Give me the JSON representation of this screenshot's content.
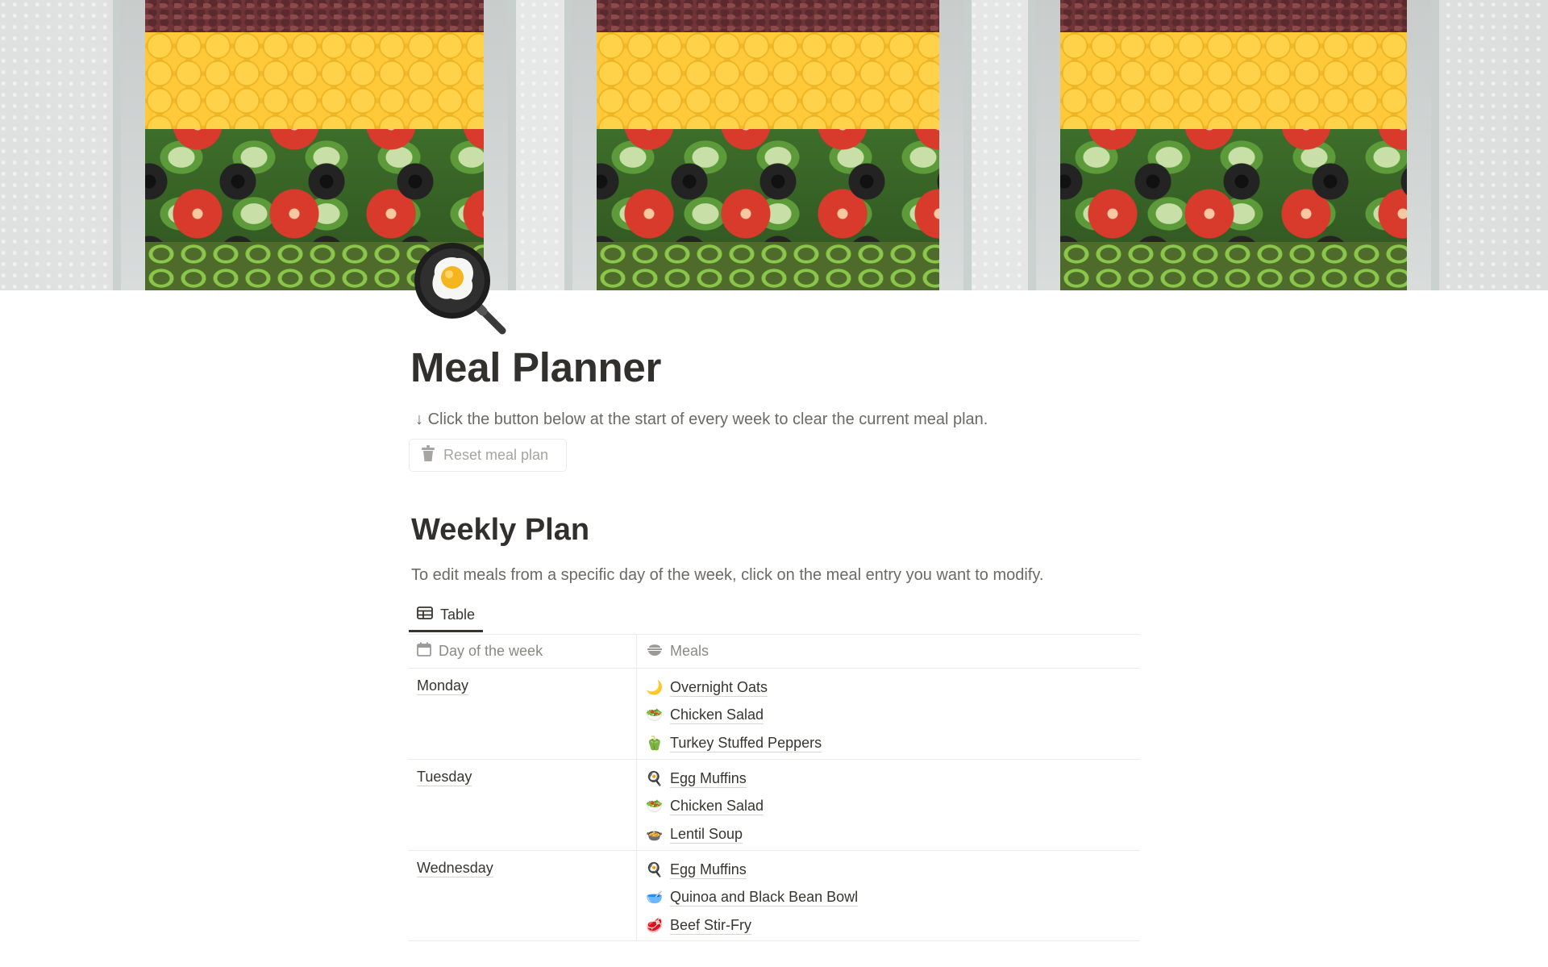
{
  "page": {
    "icon": "frying-pan-egg-icon",
    "title": "Meal Planner",
    "intro_arrow": "↓",
    "intro_text": "Click the button below at the start of every week to clear the current meal plan.",
    "reset_button": {
      "icon": "trash-icon",
      "label": "Reset meal plan"
    }
  },
  "section": {
    "title": "Weekly Plan",
    "description": "To edit meals from a specific day of the week, click on the meal entry you want to modify."
  },
  "view_tabs": [
    {
      "icon": "table-icon",
      "label": "Table",
      "active": true
    }
  ],
  "table": {
    "columns": [
      {
        "icon": "calendar-icon",
        "label": "Day of the week"
      },
      {
        "icon": "bowl-icon",
        "label": "Meals"
      }
    ],
    "rows": [
      {
        "day": "Monday",
        "meals": [
          {
            "emoji": "🌙",
            "name": "Overnight Oats"
          },
          {
            "emoji": "🥗",
            "name": "Chicken Salad"
          },
          {
            "emoji": "🫑",
            "name": "Turkey Stuffed Peppers"
          }
        ]
      },
      {
        "day": "Tuesday",
        "meals": [
          {
            "emoji": "🍳",
            "name": "Egg Muffins"
          },
          {
            "emoji": "🥗",
            "name": "Chicken Salad"
          },
          {
            "emoji": "🍲",
            "name": "Lentil Soup"
          }
        ]
      },
      {
        "day": "Wednesday",
        "meals": [
          {
            "emoji": "🍳",
            "name": "Egg Muffins"
          },
          {
            "emoji": "🥣",
            "name": "Quinoa and Black Bean Bowl"
          },
          {
            "emoji": "🥩",
            "name": "Beef Stir-Fry"
          }
        ]
      }
    ]
  }
}
